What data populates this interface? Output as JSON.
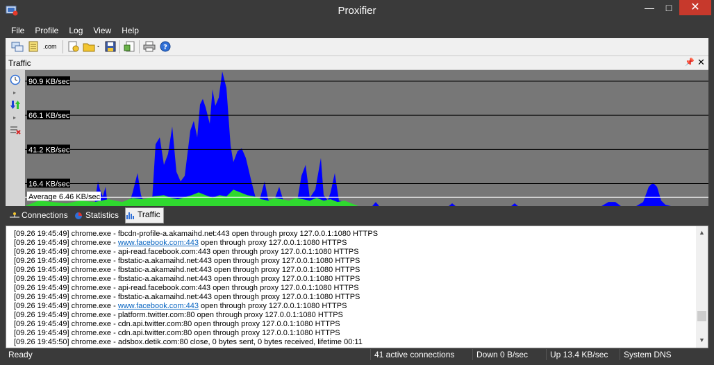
{
  "window": {
    "title": "Proxifier",
    "minimize_glyph": "—",
    "maximize_glyph": "□",
    "close_glyph": "✕"
  },
  "menu": {
    "items": [
      "File",
      "Profile",
      "Log",
      "View",
      "Help"
    ]
  },
  "toolbar": {
    "icons": [
      "connections-window-icon",
      "notepad-icon",
      "dns-com-icon",
      "new-profile-icon",
      "open-profile-icon",
      "save-profile-icon",
      "export-profile-icon",
      "print-icon",
      "help-icon"
    ],
    "com_label": ".com"
  },
  "traffic_panel": {
    "title": "Traffic",
    "pin_glyph": "📌",
    "close_glyph": "✕"
  },
  "chart_data": {
    "type": "area",
    "grid_labels": [
      "90.9 KB/sec",
      "66.1 KB/sec",
      "41.2 KB/sec",
      "16.4 KB/sec"
    ],
    "grid_values": [
      90.9,
      66.1,
      41.2,
      16.4
    ],
    "average_label": "Average 6.46 KB/sec",
    "average_value": 6.46,
    "ylim": [
      0,
      99
    ],
    "series": [
      {
        "color": "#0000ff",
        "points": [
          [
            0,
            0
          ],
          [
            100,
            0
          ],
          [
            102,
            8
          ],
          [
            105,
            18
          ],
          [
            108,
            12
          ],
          [
            112,
            7
          ],
          [
            116,
            14
          ],
          [
            118,
            5
          ],
          [
            122,
            2
          ],
          [
            150,
            2
          ],
          [
            155,
            10
          ],
          [
            162,
            24
          ],
          [
            167,
            8
          ],
          [
            172,
            2
          ],
          [
            183,
            4
          ],
          [
            188,
            45
          ],
          [
            194,
            50
          ],
          [
            200,
            30
          ],
          [
            206,
            38
          ],
          [
            212,
            58
          ],
          [
            218,
            25
          ],
          [
            224,
            18
          ],
          [
            230,
            22
          ],
          [
            238,
            55
          ],
          [
            243,
            62
          ],
          [
            248,
            50
          ],
          [
            252,
            74
          ],
          [
            256,
            78
          ],
          [
            260,
            72
          ],
          [
            266,
            60
          ],
          [
            270,
            85
          ],
          [
            274,
            73
          ],
          [
            279,
            79
          ],
          [
            284,
            98
          ],
          [
            290,
            86
          ],
          [
            296,
            44
          ],
          [
            300,
            32
          ],
          [
            306,
            40
          ],
          [
            312,
            42
          ],
          [
            318,
            35
          ],
          [
            325,
            20
          ],
          [
            332,
            6
          ],
          [
            338,
            5
          ],
          [
            345,
            18
          ],
          [
            350,
            5
          ],
          [
            356,
            2
          ],
          [
            360,
            6
          ],
          [
            366,
            14
          ],
          [
            372,
            4
          ],
          [
            380,
            3
          ],
          [
            392,
            4
          ],
          [
            398,
            22
          ],
          [
            404,
            30
          ],
          [
            410,
            6
          ],
          [
            418,
            12
          ],
          [
            426,
            35
          ],
          [
            430,
            8
          ],
          [
            436,
            4
          ],
          [
            440,
            10
          ],
          [
            446,
            24
          ],
          [
            452,
            4
          ],
          [
            470,
            2
          ],
          [
            478,
            0
          ],
          [
            500,
            0
          ],
          [
            505,
            3
          ],
          [
            510,
            0
          ],
          [
            610,
            0
          ],
          [
            615,
            2
          ],
          [
            620,
            0
          ],
          [
            700,
            0
          ],
          [
            705,
            2
          ],
          [
            710,
            0
          ],
          [
            830,
            0
          ],
          [
            840,
            3
          ],
          [
            850,
            3
          ],
          [
            858,
            0
          ],
          [
            880,
            0
          ],
          [
            890,
            3
          ],
          [
            898,
            14
          ],
          [
            904,
            17
          ],
          [
            910,
            14
          ],
          [
            916,
            4
          ],
          [
            922,
            1
          ],
          [
            930,
            0
          ],
          [
            984,
            0
          ]
        ]
      },
      {
        "color": "#2fd82f",
        "points": [
          [
            0,
            0
          ],
          [
            10,
            2
          ],
          [
            20,
            4
          ],
          [
            40,
            3
          ],
          [
            60,
            2
          ],
          [
            80,
            4
          ],
          [
            100,
            3
          ],
          [
            120,
            5
          ],
          [
            140,
            3
          ],
          [
            155,
            6
          ],
          [
            170,
            5
          ],
          [
            185,
            7
          ],
          [
            200,
            8
          ],
          [
            210,
            6
          ],
          [
            220,
            5
          ],
          [
            240,
            8
          ],
          [
            250,
            10
          ],
          [
            260,
            8
          ],
          [
            270,
            6
          ],
          [
            280,
            8
          ],
          [
            290,
            7
          ],
          [
            300,
            12
          ],
          [
            310,
            10
          ],
          [
            320,
            8
          ],
          [
            330,
            7
          ],
          [
            340,
            5
          ],
          [
            350,
            4
          ],
          [
            360,
            6
          ],
          [
            370,
            5
          ],
          [
            380,
            4
          ],
          [
            390,
            6
          ],
          [
            400,
            5
          ],
          [
            410,
            4
          ],
          [
            420,
            6
          ],
          [
            430,
            4
          ],
          [
            440,
            5
          ],
          [
            450,
            3
          ],
          [
            460,
            4
          ],
          [
            470,
            2
          ],
          [
            480,
            0
          ],
          [
            984,
            0
          ]
        ]
      }
    ]
  },
  "tabs": [
    "Connections",
    "Statistics",
    "Traffic"
  ],
  "active_tab": "Traffic",
  "log": [
    {
      "pre": "[09.26 19:45:49] chrome.exe - ",
      "link": "",
      "text": "fbcdn-profile-a.akamaihd.net:443 open through proxy 127.0.0.1:1080 HTTPS"
    },
    {
      "pre": "[09.26 19:45:49] chrome.exe - ",
      "link": "www.facebook.com:443",
      "text": " open through proxy 127.0.0.1:1080 HTTPS"
    },
    {
      "pre": "[09.26 19:45:49] chrome.exe - ",
      "link": "",
      "text": "api-read.facebook.com:443 open through proxy 127.0.0.1:1080 HTTPS"
    },
    {
      "pre": "[09.26 19:45:49] chrome.exe - ",
      "link": "",
      "text": "fbstatic-a.akamaihd.net:443 open through proxy 127.0.0.1:1080 HTTPS"
    },
    {
      "pre": "[09.26 19:45:49] chrome.exe - ",
      "link": "",
      "text": "fbstatic-a.akamaihd.net:443 open through proxy 127.0.0.1:1080 HTTPS"
    },
    {
      "pre": "[09.26 19:45:49] chrome.exe - ",
      "link": "",
      "text": "fbstatic-a.akamaihd.net:443 open through proxy 127.0.0.1:1080 HTTPS"
    },
    {
      "pre": "[09.26 19:45:49] chrome.exe - ",
      "link": "",
      "text": "api-read.facebook.com:443 open through proxy 127.0.0.1:1080 HTTPS"
    },
    {
      "pre": "[09.26 19:45:49] chrome.exe - ",
      "link": "",
      "text": "fbstatic-a.akamaihd.net:443 open through proxy 127.0.0.1:1080 HTTPS"
    },
    {
      "pre": "[09.26 19:45:49] chrome.exe - ",
      "link": "www.facebook.com:443",
      "text": " open through proxy 127.0.0.1:1080 HTTPS"
    },
    {
      "pre": "[09.26 19:45:49] chrome.exe - ",
      "link": "",
      "text": "platform.twitter.com:80 open through proxy 127.0.0.1:1080 HTTPS"
    },
    {
      "pre": "[09.26 19:45:49] chrome.exe - ",
      "link": "",
      "text": "cdn.api.twitter.com:80 open through proxy 127.0.0.1:1080 HTTPS"
    },
    {
      "pre": "[09.26 19:45:49] chrome.exe - ",
      "link": "",
      "text": "cdn.api.twitter.com:80 open through proxy 127.0.0.1:1080 HTTPS"
    },
    {
      "pre": "[09.26 19:45:50] chrome.exe - ",
      "link": "",
      "text": "adsbox.detik.com:80 close, 0 bytes sent, 0 bytes received, lifetime 00:11"
    }
  ],
  "status": {
    "ready": "Ready",
    "connections": "41 active connections",
    "down": "Down 0 B/sec",
    "up": "Up 13.4 KB/sec",
    "dns": "System DNS"
  }
}
